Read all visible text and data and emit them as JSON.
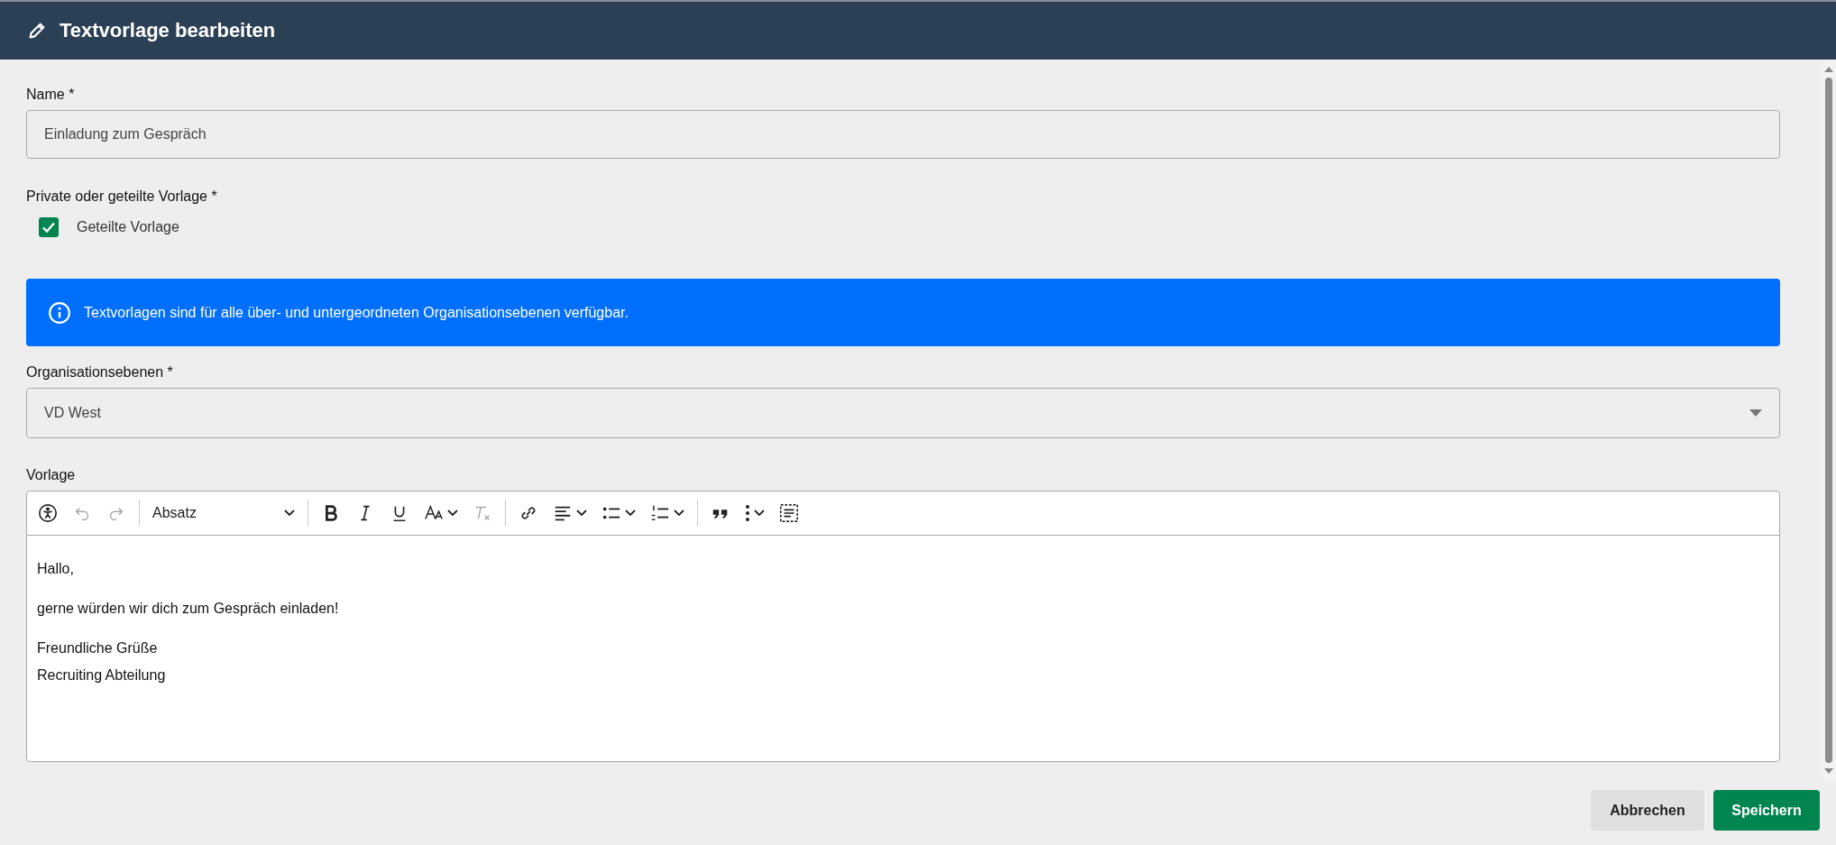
{
  "dialog": {
    "title": "Textvorlage bearbeiten"
  },
  "name_field": {
    "label": "Name *",
    "value": "Einladung zum Gespräch"
  },
  "visibility": {
    "label": "Private oder geteilte Vorlage *",
    "option": {
      "label": "Geteilte Vorlage",
      "checked": true
    }
  },
  "info_banner": {
    "text": "Textvorlagen sind für alle über- und untergeordneten Organisationsebenen verfügbar."
  },
  "org_field": {
    "label": "Organisationsebenen *",
    "value": "VD West"
  },
  "editor": {
    "label": "Vorlage",
    "toolbar": [
      {
        "kind": "accessibility",
        "disabled": false,
        "dropdown": false
      },
      {
        "kind": "undo",
        "disabled": true,
        "dropdown": false
      },
      {
        "kind": "redo",
        "disabled": true,
        "dropdown": false
      },
      {
        "kind": "separator"
      },
      {
        "kind": "heading",
        "label": "Absatz",
        "disabled": false,
        "dropdown": true
      },
      {
        "kind": "separator"
      },
      {
        "kind": "bold",
        "disabled": false,
        "dropdown": false
      },
      {
        "kind": "italic",
        "disabled": false,
        "dropdown": false
      },
      {
        "kind": "underline",
        "disabled": false,
        "dropdown": false
      },
      {
        "kind": "font-size",
        "disabled": false,
        "dropdown": true
      },
      {
        "kind": "clear-format",
        "disabled": true,
        "dropdown": false
      },
      {
        "kind": "separator"
      },
      {
        "kind": "link",
        "disabled": false,
        "dropdown": false
      },
      {
        "kind": "align",
        "disabled": false,
        "dropdown": true
      },
      {
        "kind": "bullet-list",
        "disabled": false,
        "dropdown": true
      },
      {
        "kind": "numbered-list",
        "disabled": false,
        "dropdown": true
      },
      {
        "kind": "separator"
      },
      {
        "kind": "blockquote",
        "disabled": false,
        "dropdown": false
      },
      {
        "kind": "more",
        "disabled": false,
        "dropdown": true
      },
      {
        "kind": "source",
        "disabled": false,
        "dropdown": false
      }
    ],
    "paragraphs": [
      [
        "Hallo,"
      ],
      [
        "gerne würden wir dich zum Gespräch einladen!"
      ],
      [
        "Freundliche Grüße",
        "Recruiting Abteilung"
      ]
    ]
  },
  "buttons": [
    {
      "label": "Abbrechen",
      "kind": "secondary"
    },
    {
      "label": "Speichern",
      "kind": "primary"
    }
  ]
}
